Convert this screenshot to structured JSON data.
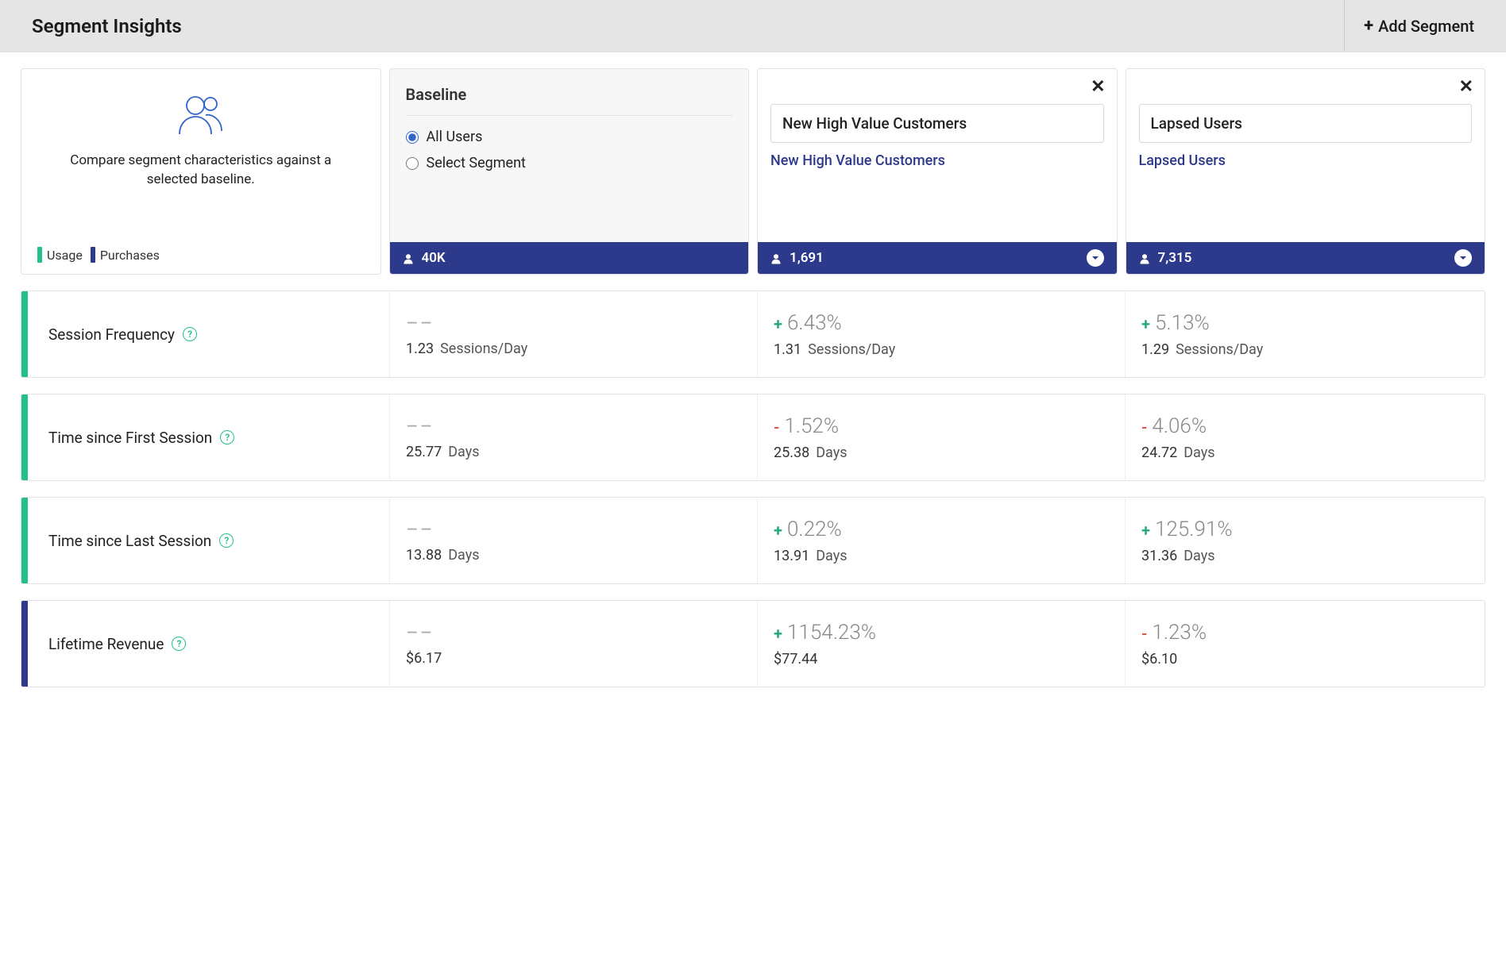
{
  "header": {
    "title": "Segment Insights",
    "add_segment_label": "Add Segment"
  },
  "intro": {
    "text": "Compare segment characteristics against a selected baseline.",
    "legend": {
      "usage": "Usage",
      "purchases": "Purchases"
    }
  },
  "baseline": {
    "label": "Baseline",
    "options": {
      "all_users": "All Users",
      "select_segment": "Select Segment"
    },
    "selected": "all_users",
    "count_label": "40K"
  },
  "segments": [
    {
      "select_label": "New High Value Customers",
      "link_label": "New High Value Customers",
      "count_label": "1,691"
    },
    {
      "select_label": "Lapsed Users",
      "link_label": "Lapsed Users",
      "count_label": "7,315"
    }
  ],
  "metrics": [
    {
      "category": "usage",
      "label": "Session Frequency",
      "baseline": {
        "value": "1.23",
        "unit": "Sessions/Day"
      },
      "cols": [
        {
          "sign": "+",
          "delta": "6.43%",
          "value": "1.31",
          "unit": "Sessions/Day"
        },
        {
          "sign": "+",
          "delta": "5.13%",
          "value": "1.29",
          "unit": "Sessions/Day"
        }
      ]
    },
    {
      "category": "usage",
      "label": "Time since First Session",
      "baseline": {
        "value": "25.77",
        "unit": "Days"
      },
      "cols": [
        {
          "sign": "-",
          "delta": "1.52%",
          "value": "25.38",
          "unit": "Days"
        },
        {
          "sign": "-",
          "delta": "4.06%",
          "value": "24.72",
          "unit": "Days"
        }
      ]
    },
    {
      "category": "usage",
      "label": "Time since Last Session",
      "baseline": {
        "value": "13.88",
        "unit": "Days"
      },
      "cols": [
        {
          "sign": "+",
          "delta": "0.22%",
          "value": "13.91",
          "unit": "Days"
        },
        {
          "sign": "+",
          "delta": "125.91%",
          "value": "31.36",
          "unit": "Days"
        }
      ]
    },
    {
      "category": "purchases",
      "label": "Lifetime Revenue",
      "baseline": {
        "value": "$6.17",
        "unit": ""
      },
      "cols": [
        {
          "sign": "+",
          "delta": "1154.23%",
          "value": "$77.44",
          "unit": ""
        },
        {
          "sign": "-",
          "delta": "1.23%",
          "value": "$6.10",
          "unit": ""
        }
      ]
    }
  ],
  "colors": {
    "usage": "#22c08a",
    "purchases": "#2d3a8c",
    "positive": "#1fa97b",
    "negative": "#e0554d"
  }
}
